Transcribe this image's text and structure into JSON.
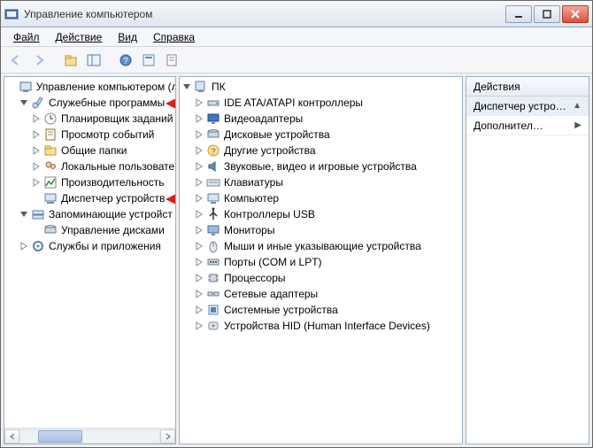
{
  "window": {
    "title": "Управление компьютером"
  },
  "menu": {
    "file": "Файл",
    "action": "Действие",
    "view": "Вид",
    "help": "Справка"
  },
  "left_tree": {
    "root": "Управление компьютером (л",
    "groups": [
      {
        "label": "Служебные программы",
        "children": [
          "Планировщик заданий",
          "Просмотр событий",
          "Общие папки",
          "Локальные пользовате",
          "Производительность",
          "Диспетчер устройств"
        ]
      },
      {
        "label": "Запоминающие устройст",
        "children": [
          "Управление дисками"
        ]
      },
      {
        "label": "Службы и приложения",
        "children": []
      }
    ]
  },
  "center_tree": {
    "root": "ПК",
    "children": [
      "IDE ATA/ATAPI контроллеры",
      "Видеоадаптеры",
      "Дисковые устройства",
      "Другие устройства",
      "Звуковые, видео и игровые устройства",
      "Клавиатуры",
      "Компьютер",
      "Контроллеры USB",
      "Мониторы",
      "Мыши и иные указывающие устройства",
      "Порты (COM и LPT)",
      "Процессоры",
      "Сетевые адаптеры",
      "Системные устройства",
      "Устройства HID (Human Interface Devices)"
    ]
  },
  "actions": {
    "header": "Действия",
    "selected": "Диспетчер устро…",
    "more": "Дополнител…"
  },
  "icons": {
    "left_root": "computer-mgmt-icon",
    "group0": "tools-icon",
    "group1": "storage-icon",
    "group2": "services-icon",
    "left_children": [
      "scheduler-icon",
      "eventviewer-icon",
      "sharedfolders-icon",
      "localusers-icon",
      "performance-icon",
      "devicemanager-icon",
      "diskmanagement-icon"
    ],
    "center_root": "pc-icon",
    "center_children": [
      "ide-icon",
      "display-icon",
      "disk-icon",
      "other-icon",
      "sound-icon",
      "keyboard-icon",
      "computer-icon",
      "usb-icon",
      "monitor-icon",
      "mouse-icon",
      "port-icon",
      "cpu-icon",
      "network-icon",
      "system-icon",
      "hid-icon"
    ]
  },
  "colors": {
    "accent": "#3b78c4",
    "red": "#d62018"
  }
}
